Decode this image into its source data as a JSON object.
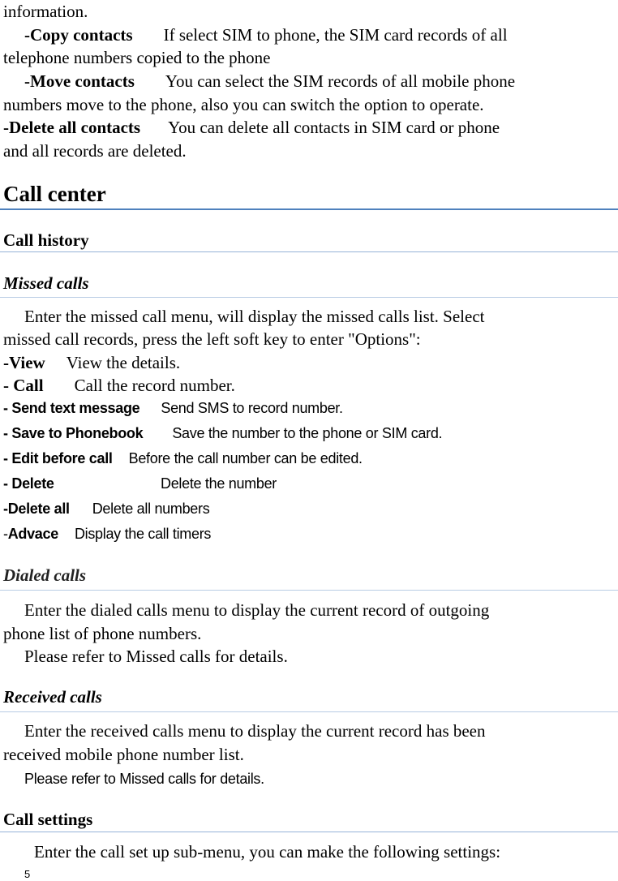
{
  "intro": {
    "line1": "information.",
    "copy_label": "-Copy contacts",
    "copy_text1": "If select SIM to phone, the SIM card records of all",
    "copy_text2": "telephone numbers copied to the phone",
    "move_label": "-Move contacts",
    "move_text1": "You can select the SIM records of all mobile phone",
    "move_text2": "numbers move to the phone, also you can switch the option to operate.",
    "delete_label": "-Delete all contacts",
    "delete_text1": "You can delete all contacts in SIM card or phone",
    "delete_text2": "and all records are deleted."
  },
  "section": {
    "title": "Call center",
    "subsection": "Call history"
  },
  "missed": {
    "title": "Missed calls",
    "para1": "Enter the missed call menu, will display the missed calls list. Select",
    "para2": "missed call records, press the left soft key to enter \"Options\":",
    "options": [
      {
        "label": "-View",
        "text": "View the details."
      },
      {
        "label": "- Call",
        "text": "Call the record number."
      },
      {
        "label": "- Send text message",
        "text": "Send SMS to record number."
      },
      {
        "label": "- Save to Phonebook",
        "text": "Save the number to the phone or SIM card."
      },
      {
        "label": "- Edit before call",
        "text": "Before the call number can be edited."
      },
      {
        "label": "- Delete",
        "text": "Delete the number"
      },
      {
        "label": "-Delete all",
        "text": "Delete all numbers"
      },
      {
        "label_prefix": "-",
        "label": "Advace",
        "text": "Display the call timers"
      }
    ]
  },
  "dialed": {
    "title": "Dialed calls",
    "para1": "Enter the dialed calls menu to display the current record of outgoing",
    "para2": "phone list of phone numbers.",
    "para3": "Please refer to Missed calls for details."
  },
  "received": {
    "title": "Received calls",
    "para1": "Enter the received calls menu to display the current record has been",
    "para2": "received mobile phone number list.",
    "para3": "Please refer to Missed calls for details."
  },
  "settings": {
    "title": "Call settings",
    "para1": "Enter the call set up sub-menu, you can make the following settings:"
  },
  "footer": {
    "page_number": "5"
  }
}
